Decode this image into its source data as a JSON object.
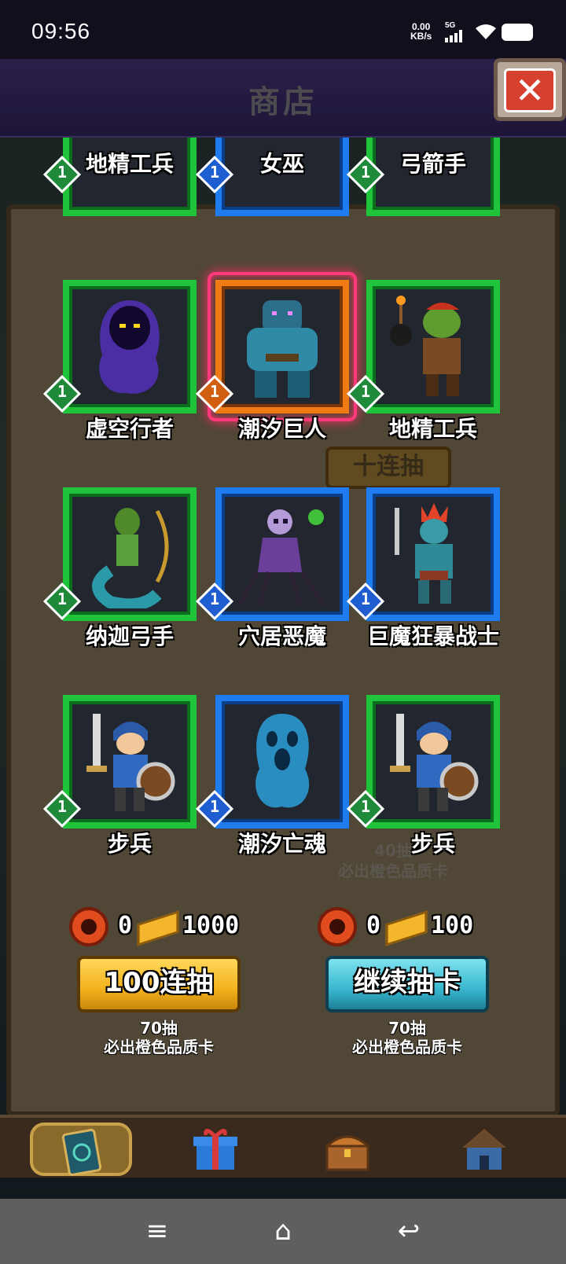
{
  "status_bar": {
    "time": "09:56",
    "net_speed_value": "0.00",
    "net_speed_unit": "KB/s",
    "network_type": "5G"
  },
  "header": {
    "title": "商店"
  },
  "top_partial_row": [
    {
      "name": "地精工兵",
      "level": "1",
      "rarity": "green"
    },
    {
      "name": "女巫",
      "level": "1",
      "rarity": "blue"
    },
    {
      "name": "弓箭手",
      "level": "1",
      "rarity": "green"
    }
  ],
  "cards": [
    {
      "name": "虚空行者",
      "level": "1",
      "rarity": "green",
      "art": "void-walker-icon"
    },
    {
      "name": "潮汐巨人",
      "level": "1",
      "rarity": "orange",
      "art": "tide-giant-icon",
      "highlighted": true
    },
    {
      "name": "地精工兵",
      "level": "1",
      "rarity": "green",
      "art": "goblin-sapper-icon"
    },
    {
      "name": "纳迦弓手",
      "level": "1",
      "rarity": "green",
      "art": "naga-archer-icon"
    },
    {
      "name": "穴居恶魔",
      "level": "1",
      "rarity": "blue",
      "art": "cave-demon-icon"
    },
    {
      "name": "巨魔狂暴战士",
      "level": "1",
      "rarity": "blue",
      "art": "troll-berserker-icon"
    },
    {
      "name": "步兵",
      "level": "1",
      "rarity": "green",
      "art": "infantry-icon"
    },
    {
      "name": "潮汐亡魂",
      "level": "1",
      "rarity": "blue",
      "art": "tide-wraith-icon"
    },
    {
      "name": "步兵",
      "level": "1",
      "rarity": "green",
      "art": "infantry-icon"
    }
  ],
  "background_faded": {
    "ten_draw_label": "十连抽",
    "forty_note_line1": "40抽",
    "forty_note_line2": "必出橙色品质卡"
  },
  "draw_left": {
    "token_count": "0",
    "gold_cost": "1000",
    "button_label": "100连抽",
    "note_line1": "70抽",
    "note_line2": "必出橙色品质卡"
  },
  "draw_right": {
    "token_count": "0",
    "gold_cost": "100",
    "button_label": "继续抽卡",
    "note_line1": "70抽",
    "note_line2": "必出橙色品质卡"
  },
  "bottom_nav": [
    {
      "icon": "card-deck-icon",
      "active": true
    },
    {
      "icon": "gift-box-icon",
      "active": false
    },
    {
      "icon": "treasure-chest-icon",
      "active": false
    },
    {
      "icon": "hut-icon",
      "active": false
    }
  ],
  "colors": {
    "rarity_green": "#1fc43a",
    "rarity_blue": "#1e7cf0",
    "rarity_orange": "#f07a14",
    "highlight_glow": "#ff3a7c",
    "button_yellow": "#f3b21c",
    "button_cyan": "#39b7cf"
  }
}
